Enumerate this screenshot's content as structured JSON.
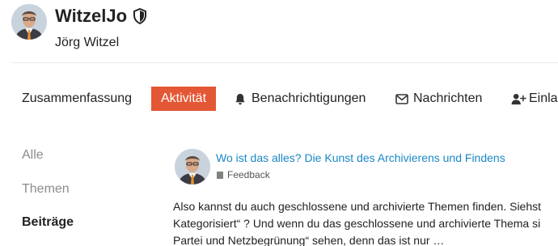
{
  "user": {
    "username": "WitzelJo",
    "full_name": "Jörg Witzel"
  },
  "nav": {
    "summary": "Zusammenfassung",
    "activity": "Aktivität",
    "notifications": "Benachrichtigungen",
    "messages": "Nachrichten",
    "invites": "Einla"
  },
  "sidebar": {
    "items": [
      {
        "label": "Alle"
      },
      {
        "label": "Themen"
      },
      {
        "label": "Beiträge"
      }
    ]
  },
  "post": {
    "title": "Wo ist das alles? Die Kunst des Archivierens und Findens",
    "category": "Feedback",
    "excerpt_lines": [
      "Also kannst du auch geschlossene und archivierte Themen finden. Siehst",
      "Kategorisiert“ ? Und wenn du das geschlossene und archivierte Thema si",
      "Partei und Netzbegrünung“ sehen, denn das ist nur …"
    ]
  },
  "colors": {
    "accent": "#e45735",
    "link": "#1a87c6",
    "category": "#808281",
    "muted": "#8c8c8c"
  },
  "icons": {
    "moderator": "shield-icon",
    "notifications": "bell-icon",
    "messages": "envelope-icon",
    "invites": "user-plus-icon"
  }
}
